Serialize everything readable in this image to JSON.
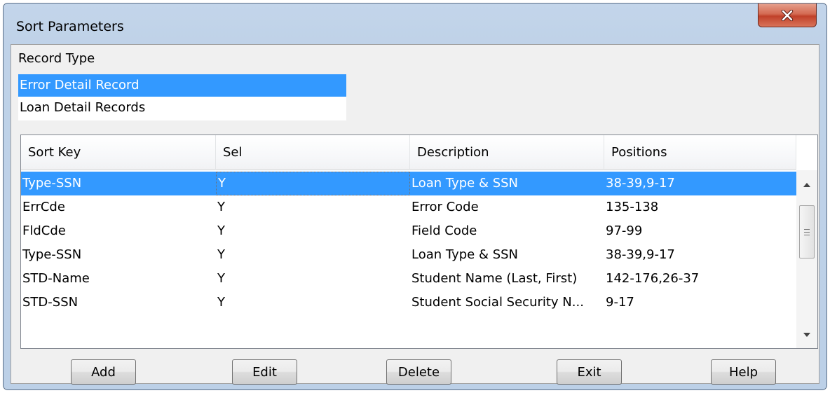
{
  "window": {
    "title": "Sort Parameters",
    "close_label": "X"
  },
  "record_type": {
    "label": "Record Type",
    "items": [
      {
        "label": "Error Detail Record",
        "selected": true
      },
      {
        "label": "Loan Detail Records",
        "selected": false
      }
    ]
  },
  "grid": {
    "columns": [
      "Sort Key",
      "Sel",
      "Description",
      "Positions"
    ],
    "rows": [
      {
        "key": "Type-SSN",
        "sel": "Y",
        "description": "Loan Type & SSN",
        "positions": "38-39,9-17"
      },
      {
        "key": "ErrCde",
        "sel": "Y",
        "description": "Error Code",
        "positions": "135-138"
      },
      {
        "key": "FldCde",
        "sel": "Y",
        "description": "Field Code",
        "positions": "97-99"
      },
      {
        "key": "Type-SSN",
        "sel": "Y",
        "description": "Loan Type & SSN",
        "positions": "38-39,9-17"
      },
      {
        "key": "STD-Name",
        "sel": "Y",
        "description": "Student Name (Last, First)",
        "positions": "142-176,26-37"
      },
      {
        "key": "STD-SSN",
        "sel": "Y",
        "description": "Student Social Security N...",
        "positions": "9-17"
      }
    ]
  },
  "buttons": {
    "add": "Add",
    "edit": "Edit",
    "delete": "Delete",
    "exit": "Exit",
    "help": "Help"
  },
  "colors": {
    "selection": "#3399ff",
    "frame": "#bfd2e8",
    "close": "#c8462e"
  }
}
